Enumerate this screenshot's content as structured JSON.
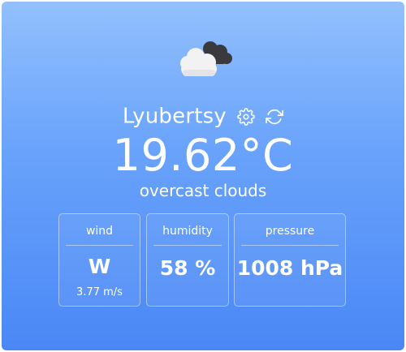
{
  "weather": {
    "city": "Lyubertsy",
    "temperature": "19.62°C",
    "description": "overcast clouds",
    "condition_icon": "overcast-clouds-icon"
  },
  "actions": {
    "settings_icon": "gear-icon",
    "refresh_icon": "refresh-icon"
  },
  "stats": {
    "wind": {
      "label": "wind",
      "direction": "W",
      "speed": "3.77 m/s"
    },
    "humidity": {
      "label": "humidity",
      "value": "58 %"
    },
    "pressure": {
      "label": "pressure",
      "value": "1008 hPa"
    }
  },
  "colors": {
    "gradient_top": "#93c0fd",
    "gradient_bottom": "#4a87f6",
    "text": "#ffffff",
    "cloud_dark": "#3a3a3e",
    "cloud_light": "#f2f2f2"
  }
}
